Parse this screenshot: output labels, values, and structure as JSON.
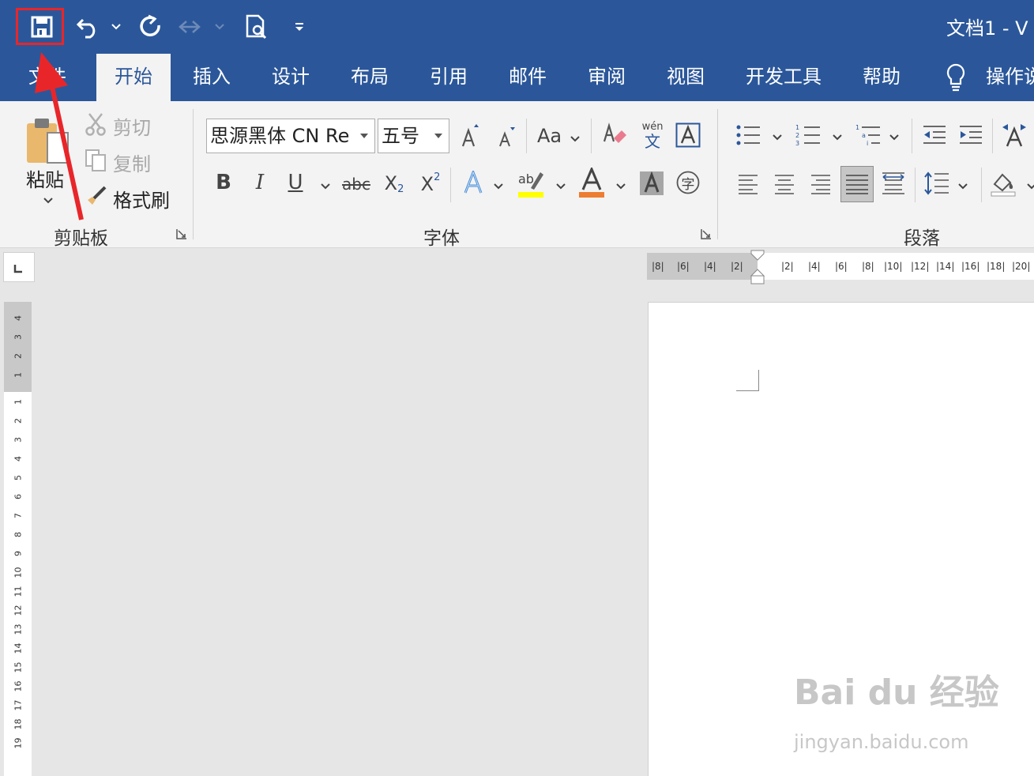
{
  "titlebar": {
    "doc_title": "文档1  -  V"
  },
  "tabs": [
    {
      "label": "文件"
    },
    {
      "label": "开始"
    },
    {
      "label": "插入"
    },
    {
      "label": "设计"
    },
    {
      "label": "布局"
    },
    {
      "label": "引用"
    },
    {
      "label": "邮件"
    },
    {
      "label": "审阅"
    },
    {
      "label": "视图"
    },
    {
      "label": "开发工具"
    },
    {
      "label": "帮助"
    },
    {
      "label": "操作说"
    }
  ],
  "clipboard": {
    "paste_label": "粘贴",
    "cut_label": "剪切",
    "copy_label": "复制",
    "format_painter_label": "格式刷",
    "group_label": "剪贴板"
  },
  "font": {
    "font_name": "思源黑体 CN Re",
    "font_size": "五号",
    "change_case_label": "Aa",
    "phonetic_top": "wén",
    "phonetic_bottom": "文",
    "bold": "B",
    "italic": "I",
    "underline": "U",
    "strikethrough": "abc",
    "subscript": "X",
    "subscript_mark": "2",
    "superscript": "X",
    "superscript_mark": "2",
    "enclosed_char": "字",
    "group_label": "字体",
    "highlight_color": "#ffff00",
    "font_color": "#ed7d31"
  },
  "paragraph": {
    "group_label": "段落"
  },
  "hruler_numbers": [
    "8",
    "6",
    "4",
    "2",
    "2",
    "4",
    "6",
    "8",
    "10",
    "12",
    "14",
    "16",
    "18",
    "20"
  ],
  "vruler_numbers": [
    "4",
    "3",
    "2",
    "1",
    "1",
    "2",
    "3",
    "4",
    "5",
    "6",
    "7",
    "8",
    "9",
    "10",
    "11",
    "12",
    "13",
    "14",
    "15",
    "16",
    "17",
    "18",
    "19"
  ],
  "watermark": {
    "main": "Bai du 经验",
    "sub": "jingyan.baidu.com"
  },
  "colors": {
    "brand": "#2b579a",
    "highlight_box": "#e8262a"
  }
}
